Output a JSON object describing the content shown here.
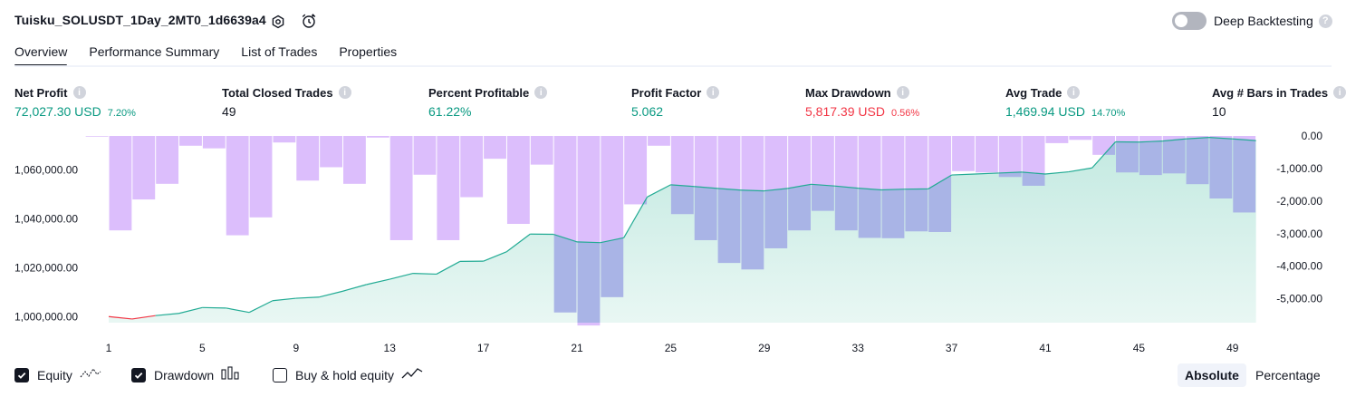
{
  "header": {
    "title": "Tuisku_SOLUSDT_1Day_2MT0_1d6639a4",
    "deep_backtesting_label": "Deep Backtesting",
    "deep_backtesting_enabled": false
  },
  "tabs": [
    {
      "label": "Overview",
      "active": true
    },
    {
      "label": "Performance Summary",
      "active": false
    },
    {
      "label": "List of Trades",
      "active": false
    },
    {
      "label": "Properties",
      "active": false
    }
  ],
  "metrics": {
    "net_profit": {
      "label": "Net Profit",
      "value": "72,027.30 USD",
      "pct": "7.20%"
    },
    "total_closed_trades": {
      "label": "Total Closed Trades",
      "value": "49"
    },
    "percent_profitable": {
      "label": "Percent Profitable",
      "value": "61.22%"
    },
    "profit_factor": {
      "label": "Profit Factor",
      "value": "5.062"
    },
    "max_drawdown": {
      "label": "Max Drawdown",
      "value": "5,817.39 USD",
      "pct": "0.56%"
    },
    "avg_trade": {
      "label": "Avg Trade",
      "value": "1,469.94 USD",
      "pct": "14.70%"
    },
    "avg_bars": {
      "label": "Avg # Bars in Trades",
      "value": "10"
    }
  },
  "colors": {
    "positive": "#089981",
    "negative": "#f23645",
    "equity_line": "#22ab94",
    "equity_fill": "#c8ece4",
    "drawdown_bar": "#cfa5fb",
    "drawdown_overlap": "#a9b4e6"
  },
  "chart_data": {
    "type": "area",
    "x_tick_labels": [
      "1",
      "5",
      "9",
      "13",
      "17",
      "21",
      "25",
      "29",
      "33",
      "37",
      "41",
      "45",
      "49"
    ],
    "left_axis": {
      "label": "Equity",
      "tick_labels": [
        "1,060,000.00",
        "1,040,000.00",
        "1,020,000.00",
        "1,000,000.00"
      ],
      "tick_values": [
        1060000,
        1040000,
        1020000,
        1000000
      ],
      "range": [
        997500,
        1074000
      ]
    },
    "right_axis": {
      "label": "Drawdown",
      "tick_labels": [
        "0.00",
        "-1,000.00",
        "-2,000.00",
        "-3,000.00",
        "-4,000.00",
        "-5,000.00"
      ],
      "tick_values": [
        0,
        -1000,
        -2000,
        -3000,
        -4000,
        -5000
      ],
      "range": [
        -5817.39,
        0
      ]
    },
    "series": [
      {
        "name": "Equity",
        "x": [
          1,
          2,
          3,
          4,
          5,
          6,
          7,
          8,
          9,
          10,
          11,
          12,
          13,
          14,
          15,
          16,
          17,
          18,
          19,
          20,
          21,
          22,
          23,
          24,
          25,
          26,
          27,
          28,
          29,
          30,
          31,
          32,
          33,
          34,
          35,
          36,
          37,
          38,
          39,
          40,
          41,
          42,
          43,
          44,
          45,
          46,
          47,
          48,
          49,
          50
        ],
        "values": [
          1000000,
          999000,
          1000400,
          1001300,
          1003700,
          1003500,
          1001700,
          1006500,
          1007500,
          1008000,
          1010400,
          1013100,
          1015300,
          1017700,
          1017400,
          1022600,
          1022700,
          1026600,
          1033800,
          1033700,
          1030600,
          1030300,
          1032300,
          1049000,
          1054000,
          1053300,
          1052500,
          1051800,
          1051500,
          1052500,
          1054200,
          1053500,
          1052600,
          1051900,
          1052200,
          1052300,
          1058000,
          1058400,
          1058800,
          1059200,
          1058400,
          1059300,
          1060900,
          1071600,
          1071500,
          1071900,
          1072800,
          1073400,
          1072800,
          1072100
        ]
      },
      {
        "name": "Drawdown",
        "x": [
          1,
          2,
          3,
          4,
          5,
          6,
          7,
          8,
          9,
          10,
          11,
          12,
          13,
          14,
          15,
          16,
          17,
          18,
          19,
          20,
          21,
          22,
          23,
          24,
          25,
          26,
          27,
          28,
          29,
          30,
          31,
          32,
          33,
          34,
          35,
          36,
          37,
          38,
          39,
          40,
          41,
          42,
          43,
          44,
          45,
          46,
          47,
          48,
          49,
          50
        ],
        "values": [
          -20,
          -2900,
          -1950,
          -1470,
          -300,
          -380,
          -3050,
          -2500,
          -200,
          -1370,
          -960,
          -1470,
          -50,
          -3200,
          -1190,
          -3200,
          -1880,
          -700,
          -2700,
          -880,
          -5420,
          -5820,
          -4950,
          -2100,
          -300,
          -2400,
          -3200,
          -3900,
          -4100,
          -3450,
          -2900,
          -2300,
          -2900,
          -3130,
          -3140,
          -2930,
          -2950,
          -1080,
          -1120,
          -1260,
          -1530,
          -220,
          -120,
          -580,
          -1120,
          -1200,
          -1150,
          -1480,
          -1920,
          -2350
        ]
      }
    ]
  },
  "legend": {
    "equity": {
      "label": "Equity",
      "checked": true
    },
    "drawdown": {
      "label": "Drawdown",
      "checked": true
    },
    "buy_hold": {
      "label": "Buy & hold equity",
      "checked": false
    }
  },
  "view_mode": {
    "absolute_label": "Absolute",
    "percentage_label": "Percentage",
    "selected": "Absolute"
  }
}
